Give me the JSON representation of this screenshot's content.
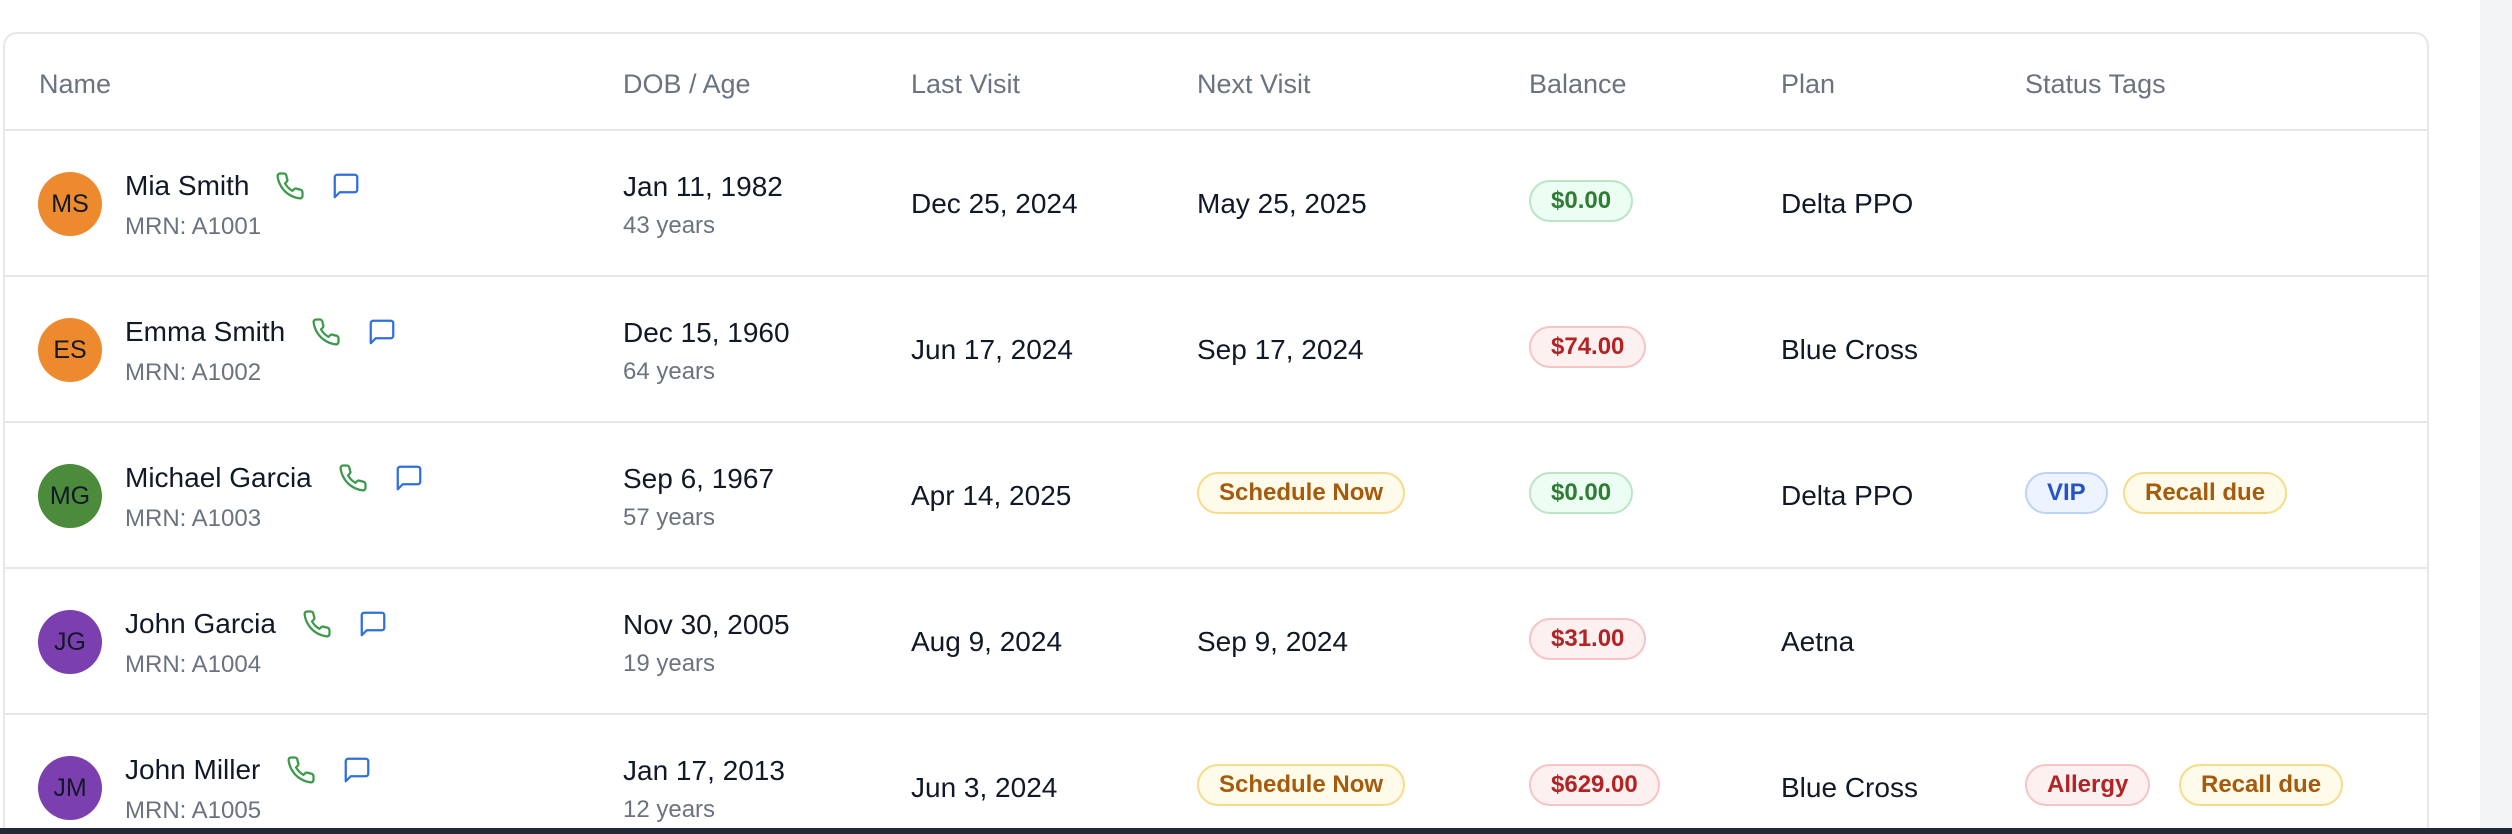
{
  "table": {
    "columns": [
      "Name",
      "DOB / Age",
      "Last Visit",
      "Next Visit",
      "Balance",
      "Plan",
      "Status Tags"
    ],
    "rows": [
      {
        "initials": "MS",
        "avatar_color": "#ee8a2e",
        "name": "Mia Smith",
        "mrn": "MRN: A1001",
        "dob": "Jan 11, 1982",
        "age": "43 years",
        "last_visit": "Dec 25, 2024",
        "next_visit": "May 25, 2025",
        "next_visit_is_action": false,
        "balance": "$0.00",
        "balance_status": "paid",
        "plan": "Delta PPO",
        "tags": []
      },
      {
        "initials": "ES",
        "avatar_color": "#ee8a2e",
        "name": "Emma Smith",
        "mrn": "MRN: A1002",
        "dob": "Dec 15, 1960",
        "age": "64 years",
        "last_visit": "Jun 17, 2024",
        "next_visit": "Sep 17, 2024",
        "next_visit_is_action": false,
        "balance": "$74.00",
        "balance_status": "owed",
        "plan": "Blue Cross",
        "tags": []
      },
      {
        "initials": "MG",
        "avatar_color": "#4b8b3b",
        "name": "Michael Garcia",
        "mrn": "MRN: A1003",
        "dob": "Sep 6, 1967",
        "age": "57 years",
        "last_visit": "Apr 14, 2025",
        "next_visit": "Schedule Now",
        "next_visit_is_action": true,
        "balance": "$0.00",
        "balance_status": "paid",
        "plan": "Delta PPO",
        "tags": [
          {
            "label": "VIP",
            "color": "blue"
          },
          {
            "label": "Recall due",
            "color": "amber"
          }
        ]
      },
      {
        "initials": "JG",
        "avatar_color": "#7b3fb0",
        "name": "John Garcia",
        "mrn": "MRN: A1004",
        "dob": "Nov 30, 2005",
        "age": "19 years",
        "last_visit": "Aug 9, 2024",
        "next_visit": "Sep 9, 2024",
        "next_visit_is_action": false,
        "balance": "$31.00",
        "balance_status": "owed",
        "plan": "Aetna",
        "tags": []
      },
      {
        "initials": "JM",
        "avatar_color": "#7b3fb0",
        "name": "John Miller",
        "mrn": "MRN: A1005",
        "dob": "Jan 17, 2013",
        "age": "12 years",
        "last_visit": "Jun 3, 2024",
        "next_visit": "Schedule Now",
        "next_visit_is_action": true,
        "balance": "$629.00",
        "balance_status": "owed",
        "plan": "Blue Cross",
        "tags": [
          {
            "label": "Allergy",
            "color": "red"
          },
          {
            "label": "Recall due",
            "color": "amber"
          }
        ]
      }
    ]
  },
  "icons": {
    "call": "phone-icon",
    "message": "message-icon"
  },
  "colors": {
    "phone_icon": "#3a9a4a",
    "message_icon": "#2f6fe0",
    "paid": "#2e7d32",
    "owed": "#b42323",
    "action": "#a65a0b"
  }
}
